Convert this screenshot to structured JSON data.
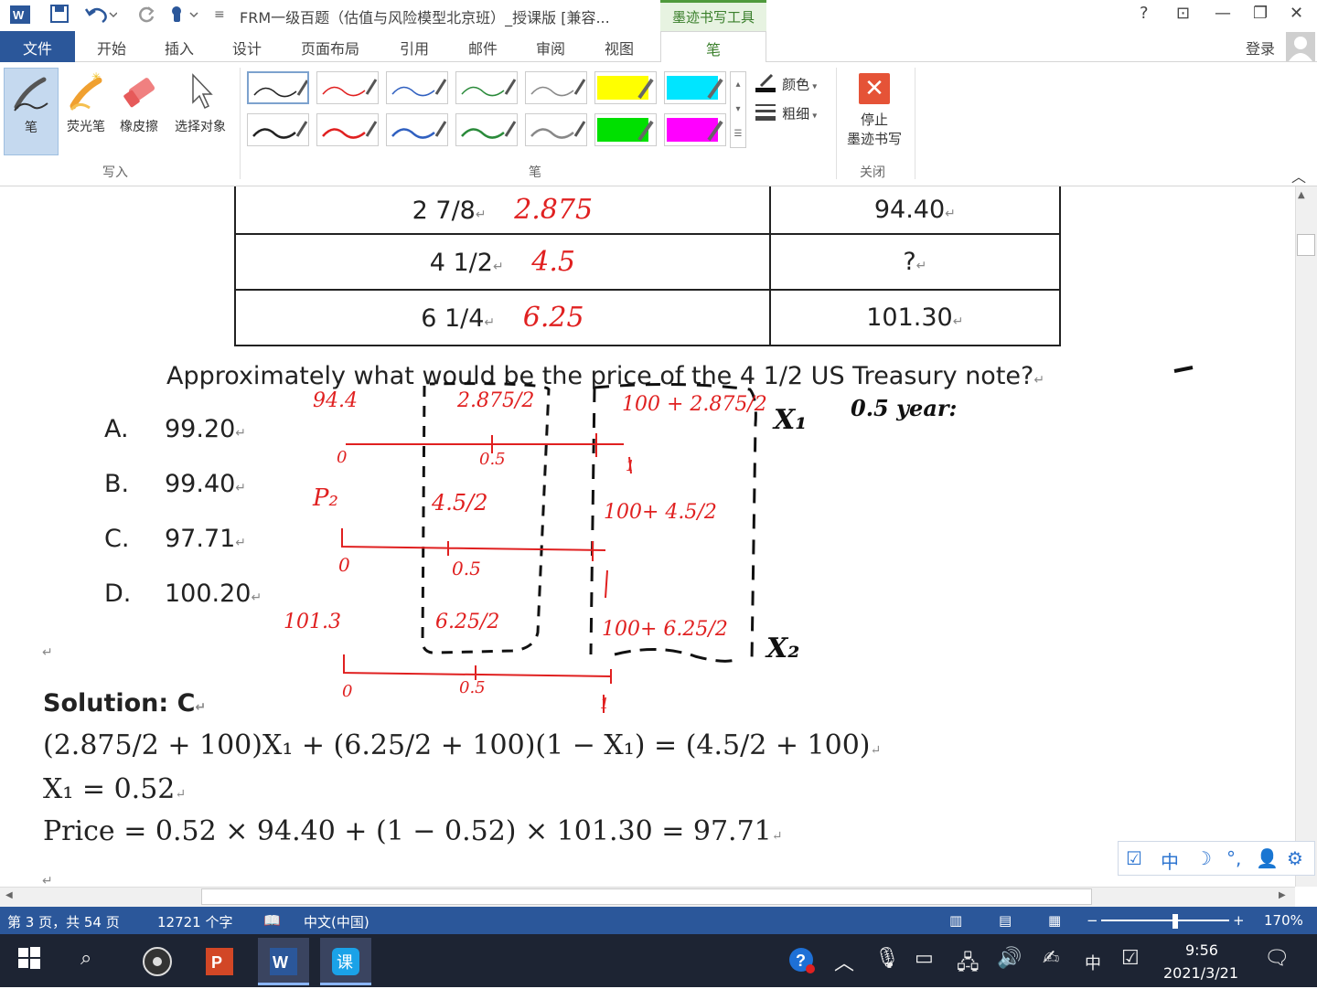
{
  "titlebar": {
    "doc_title": "FRM一级百题（估值与风险模型北京班）_授课版 [兼容...",
    "context_tab": "墨迹书写工具",
    "help": "?",
    "restore_ribbon": "⊡",
    "minimize": "—",
    "maximize": "❐",
    "close": "✕"
  },
  "tabs": {
    "file": "文件",
    "items": [
      "开始",
      "插入",
      "设计",
      "页面布局",
      "引用",
      "邮件",
      "审阅",
      "视图"
    ],
    "active": "笔",
    "login": "登录"
  },
  "ribbon": {
    "write_group": {
      "label": "写入",
      "pen": "笔",
      "highlighter": "荧光笔",
      "eraser": "橡皮擦",
      "select": "选择对象"
    },
    "pen_group": {
      "label": "笔",
      "color": "颜色",
      "thickness": "粗细",
      "swatch_colors": [
        "#222222",
        "#e02020",
        "#3060c0",
        "#2a8a3a",
        "#888888",
        "#ffff00",
        "#00e5ff",
        "#222222",
        "#e02020",
        "#3060c0",
        "#2a8a3a",
        "#888888",
        "#00e000",
        "#ff00ff"
      ]
    },
    "close_group": {
      "label": "关闭",
      "stop_line1": "停止",
      "stop_line2": "墨迹书写"
    }
  },
  "document": {
    "table_rows": [
      {
        "coupon": "2 7/8",
        "price": "94.40",
        "ink": "2.875"
      },
      {
        "coupon": "4 1/2",
        "price": "?",
        "ink": "4.5"
      },
      {
        "coupon": "6 1/4",
        "price": "101.30",
        "ink": "6.25"
      }
    ],
    "question": "Approximately what would be the price of the 4 1/2 US Treasury note?",
    "options": [
      {
        "letter": "A.",
        "value": "99.20"
      },
      {
        "letter": "B.",
        "value": "99.40"
      },
      {
        "letter": "C.",
        "value": "97.71"
      },
      {
        "letter": "D.",
        "value": "100.20"
      }
    ],
    "solution_label": "Solution: C",
    "eq1": "(2.875/2 + 100)X₁ + (6.25/2 + 100)(1 − X₁) = (4.5/2 + 100)",
    "eq2": "X₁ = 0.52",
    "eq3": "Price = 0.52 × 94.40 + (1 − 0.52) × 101.30 = 97.71",
    "para_mark": "↵"
  },
  "ink_annotations": {
    "red": [
      "94.4",
      "2.875/2",
      "100 + 2.875/2",
      "0",
      "0.5",
      "1",
      "P₂",
      "4.5/2",
      "100+ 4.5/2",
      "0",
      "0.5",
      "101.3",
      "6.25/2",
      "100+ 6.25/2",
      "0",
      "0.5",
      "1"
    ],
    "black": [
      "X₁",
      "0.5 year:",
      "X₂"
    ]
  },
  "ime": {
    "chinese": "中"
  },
  "status": {
    "page": "第 3 页，共 54 页",
    "words": "12721 个字",
    "language": "中文(中国)",
    "zoom": "170%"
  },
  "taskbar": {
    "time": "9:56",
    "date": "2021/3/21",
    "ime": "中"
  },
  "colors": {
    "word_blue": "#2b579a",
    "ink_red": "#e02020",
    "ink_green_tab": "#3a7f2b"
  }
}
